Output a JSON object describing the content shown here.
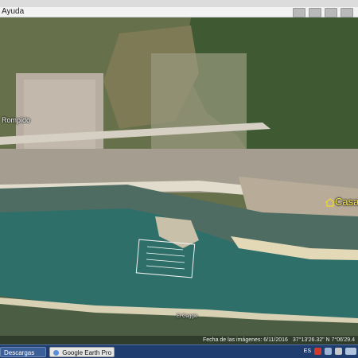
{
  "menubar": {
    "help_label": "Ayuda"
  },
  "map": {
    "place_left": "Rompido",
    "place_right": "Casa",
    "place_bottom": "El Gaggio"
  },
  "status": {
    "image_date": "Fecha de las imágenes: 6/11/2016",
    "coordinates": "37°13'26.32\" N    7°06'29.4"
  },
  "taskbar": {
    "downloads_label": "Descargas",
    "app_label": "Google Earth Pro",
    "lang": "ES",
    "colors": {
      "bar": "#1f3d6e",
      "button": "#3b5f99",
      "active": "#e6e6e6"
    }
  },
  "colors": {
    "water": "#2f6f6a",
    "land": "#6f7a4f",
    "sand": "#d8cfae",
    "marker": "#e8d23a"
  }
}
